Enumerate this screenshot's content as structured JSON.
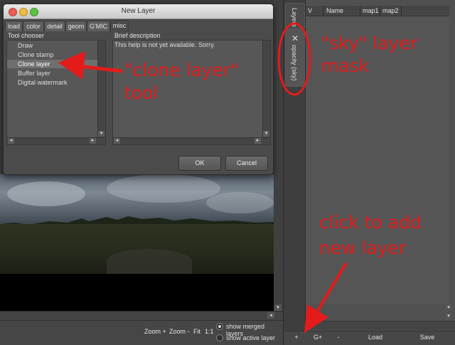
{
  "dialog": {
    "title": "New Layer",
    "tabs": [
      "load",
      "color",
      "detail",
      "geom",
      "G'MIC",
      "misc"
    ],
    "selected_tab": "misc",
    "tool_chooser_label": "Tool chooser",
    "tools": [
      "Draw",
      "Clone stamp",
      "Clone layer",
      "Buffer layer",
      "Digital watermark"
    ],
    "selected_tool": "Clone layer",
    "brief_description_label": "Brief description",
    "description_text": "This help is not yet available. Sorry.",
    "ok_label": "OK",
    "cancel_label": "Cancel"
  },
  "bottom_bar": {
    "zoom_in": "Zoom +",
    "zoom_out": "Zoom -",
    "fit": "Fit",
    "one_to_one": "1:1",
    "show_merged_layers": "show merged layers",
    "show_active_layer": "show active layer",
    "merged_selected": true
  },
  "dock": {
    "tab_layers": "Layers",
    "tab_mask": "opacity (sky)",
    "close_glyph": "✕"
  },
  "layers_panel": {
    "columns": [
      "V",
      "Name",
      "map1",
      "map2"
    ],
    "buttons": [
      "+",
      "G+",
      "-",
      "Load",
      "Save"
    ]
  },
  "annotations": {
    "clone_tool_line1": "\"clone layer\"",
    "clone_tool_line2": "tool",
    "sky_mask_line1": "\"sky\" layer",
    "sky_mask_line2": "mask",
    "add_layer_line1": "click to add",
    "add_layer_line2": "new layer"
  },
  "colors": {
    "annotation_red": "#e31b1b",
    "panel_bg": "#505050",
    "dialog_bg": "#4b4b4b"
  }
}
